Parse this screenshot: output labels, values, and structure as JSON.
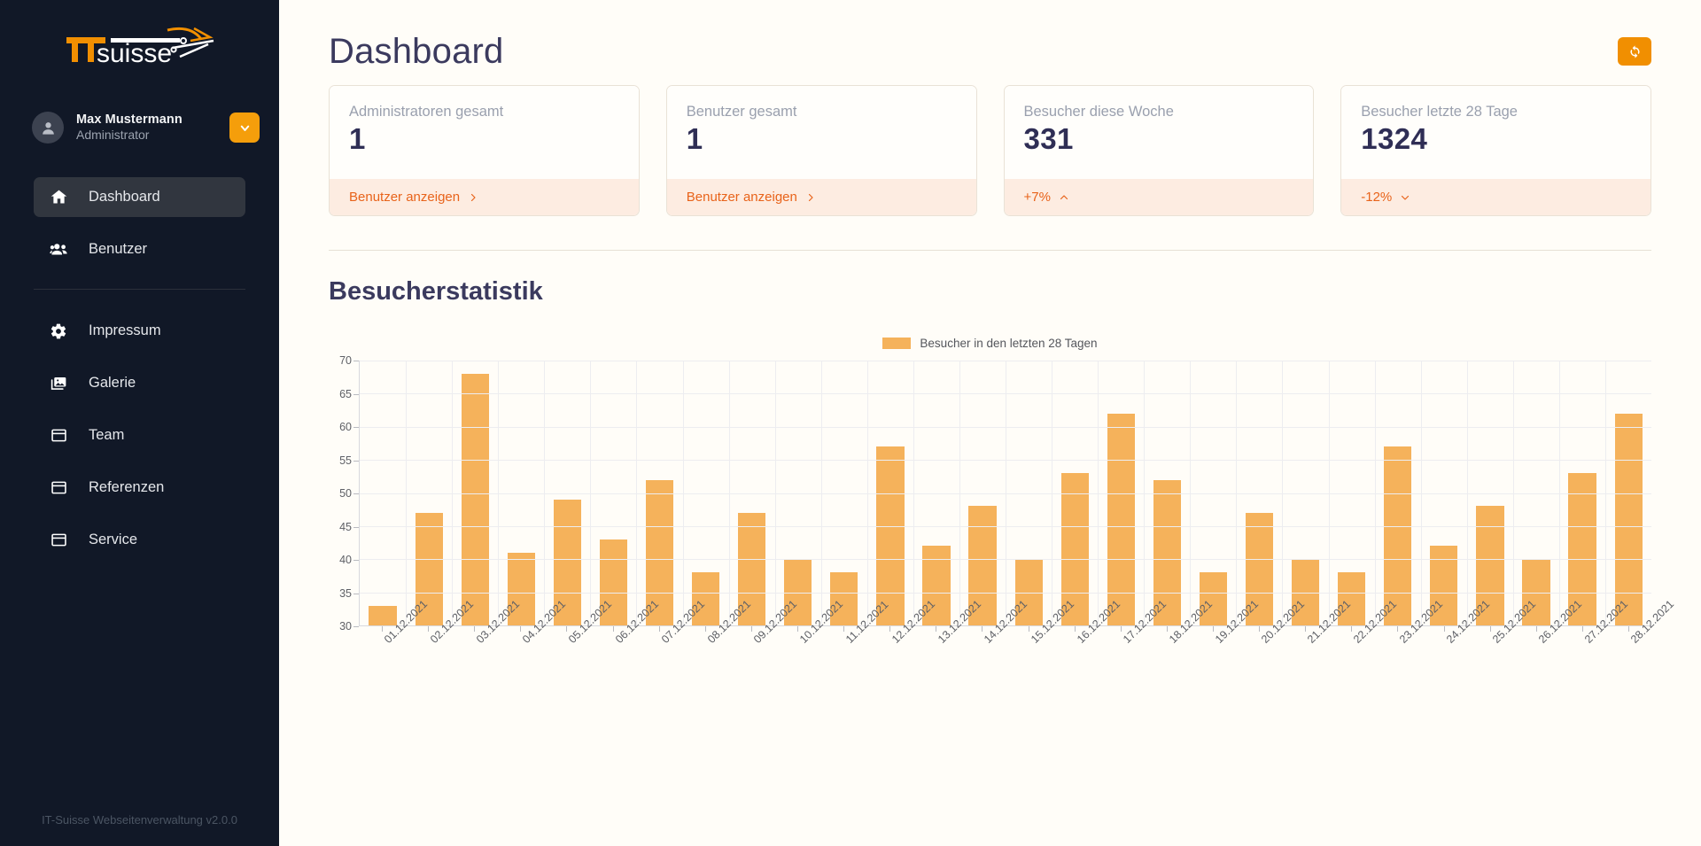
{
  "brand": {
    "logo_text_it": "IT",
    "logo_text_suisse": "suisse",
    "accent": "#f59e0b",
    "orange": "#f18f01"
  },
  "sidebar": {
    "user": {
      "name": "Max Mustermann",
      "role": "Administrator"
    },
    "items": [
      {
        "label": "Dashboard",
        "icon": "home-icon",
        "active": true
      },
      {
        "label": "Benutzer",
        "icon": "users-icon",
        "active": false
      },
      {
        "label": "Impressum",
        "icon": "gear-icon",
        "active": false
      },
      {
        "label": "Galerie",
        "icon": "images-icon",
        "active": false
      },
      {
        "label": "Team",
        "icon": "window-icon",
        "active": false
      },
      {
        "label": "Referenzen",
        "icon": "window-icon",
        "active": false
      },
      {
        "label": "Service",
        "icon": "window-icon",
        "active": false
      }
    ],
    "separator_after_index": 1,
    "footer": "IT-Suisse Webseitenverwaltung v2.0.0"
  },
  "header": {
    "title": "Dashboard",
    "refresh_icon": "refresh-icon"
  },
  "cards": [
    {
      "label": "Administratoren gesamt",
      "value": "1",
      "foot_text": "Benutzer anzeigen",
      "foot_icon": "chevron-right-icon"
    },
    {
      "label": "Benutzer gesamt",
      "value": "1",
      "foot_text": "Benutzer anzeigen",
      "foot_icon": "chevron-right-icon"
    },
    {
      "label": "Besucher diese Woche",
      "value": "331",
      "foot_text": "+7%",
      "foot_icon": "chevron-up-icon"
    },
    {
      "label": "Besucher letzte 28 Tage",
      "value": "1324",
      "foot_text": "-12%",
      "foot_icon": "chevron-down-icon"
    }
  ],
  "section": {
    "title": "Besucherstatistik"
  },
  "chart_data": {
    "type": "bar",
    "title": "Besucherstatistik",
    "xlabel": "",
    "ylabel": "",
    "ylim": [
      30,
      70
    ],
    "yticks": [
      30,
      35,
      40,
      45,
      50,
      55,
      60,
      65,
      70
    ],
    "grid": true,
    "legend_position": "top-center",
    "legend": [
      "Besucher in den letzten 28 Tagen"
    ],
    "bar_color": "#f5b25b",
    "categories": [
      "01.12.2021",
      "02.12.2021",
      "03.12.2021",
      "04.12.2021",
      "05.12.2021",
      "06.12.2021",
      "07.12.2021",
      "08.12.2021",
      "09.12.2021",
      "10.12.2021",
      "11.12.2021",
      "12.12.2021",
      "13.12.2021",
      "14.12.2021",
      "15.12.2021",
      "16.12.2021",
      "17.12.2021",
      "18.12.2021",
      "19.12.2021",
      "20.12.2021",
      "21.12.2021",
      "22.12.2021",
      "23.12.2021",
      "24.12.2021",
      "25.12.2021",
      "26.12.2021",
      "27.12.2021",
      "28.12.2021"
    ],
    "series": [
      {
        "name": "Besucher in den letzten 28 Tagen",
        "values": [
          33,
          47,
          68,
          41,
          49,
          43,
          52,
          38,
          47,
          40,
          38,
          57,
          42,
          48,
          40,
          53,
          62,
          52,
          38,
          47,
          40,
          38,
          57,
          42,
          48,
          40,
          53,
          62
        ]
      }
    ]
  }
}
